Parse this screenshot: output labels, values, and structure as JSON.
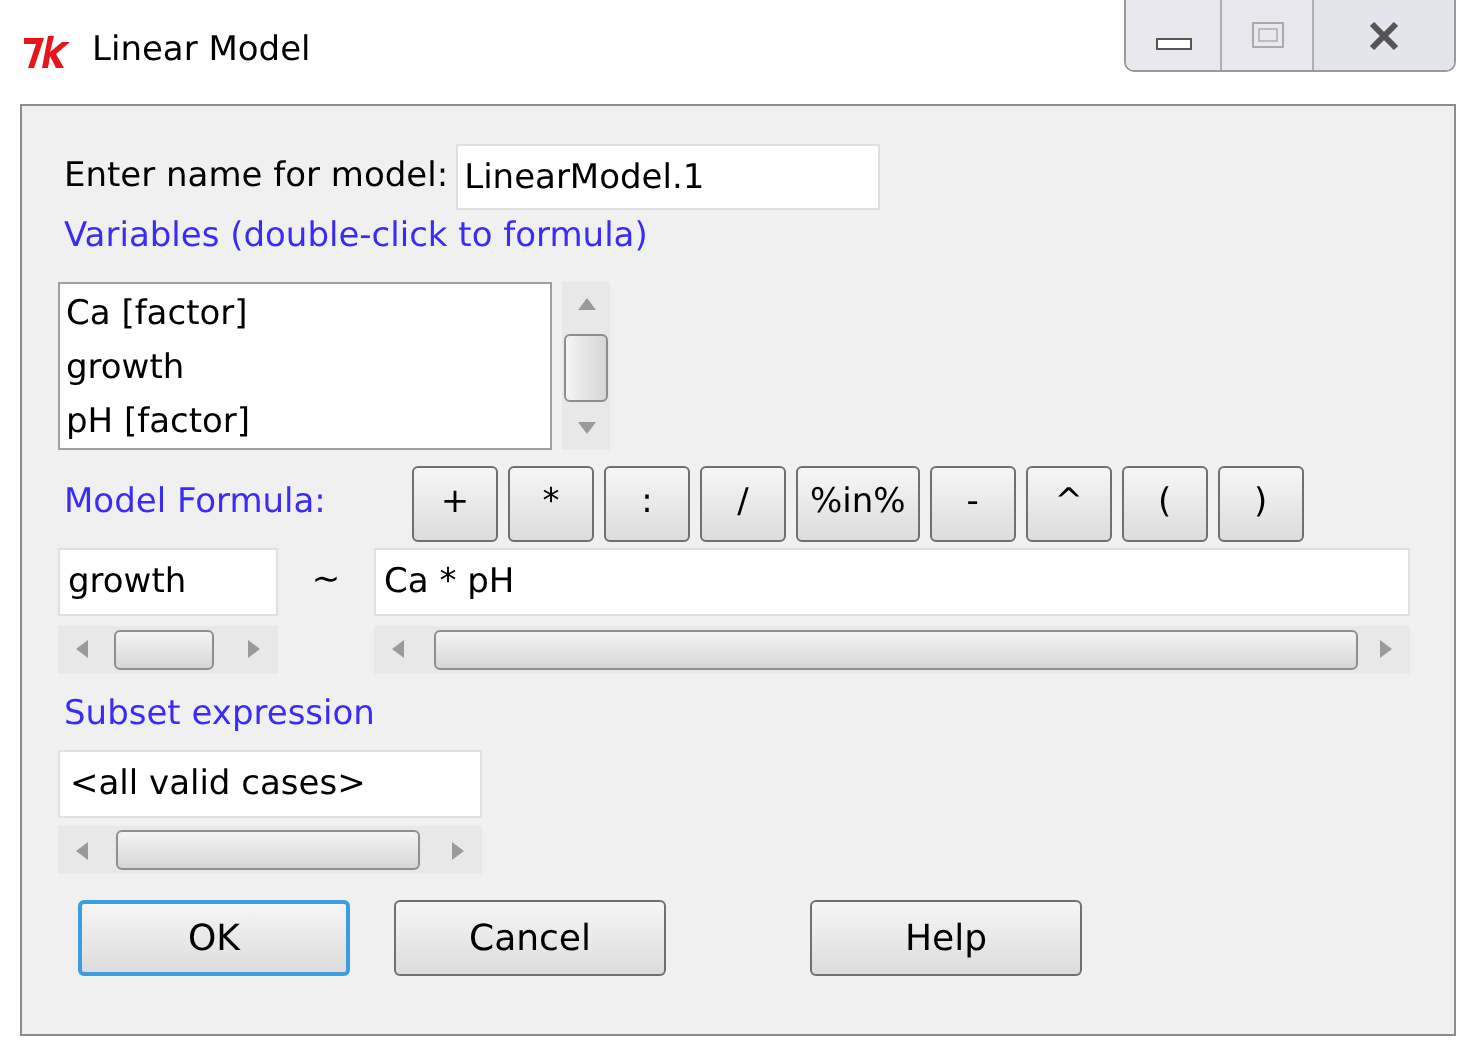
{
  "window": {
    "title": "Linear Model"
  },
  "name_field": {
    "label": "Enter name for model:",
    "value": "LinearModel.1"
  },
  "variables": {
    "label": "Variables (double-click to formula)",
    "items": [
      "Ca [factor]",
      "growth",
      "pH [factor]"
    ]
  },
  "formula": {
    "label": "Model Formula:",
    "operators": [
      "+",
      "*",
      ":",
      "/",
      "%in%",
      "-",
      "^",
      "(",
      ")"
    ],
    "lhs": "growth",
    "tilde": "~",
    "rhs": "Ca * pH"
  },
  "subset": {
    "label": "Subset expression",
    "value": "<all valid cases>"
  },
  "buttons": [
    {
      "label": "OK",
      "default": true
    },
    {
      "label": "Cancel",
      "default": false
    },
    {
      "label": "Help",
      "default": false
    }
  ]
}
